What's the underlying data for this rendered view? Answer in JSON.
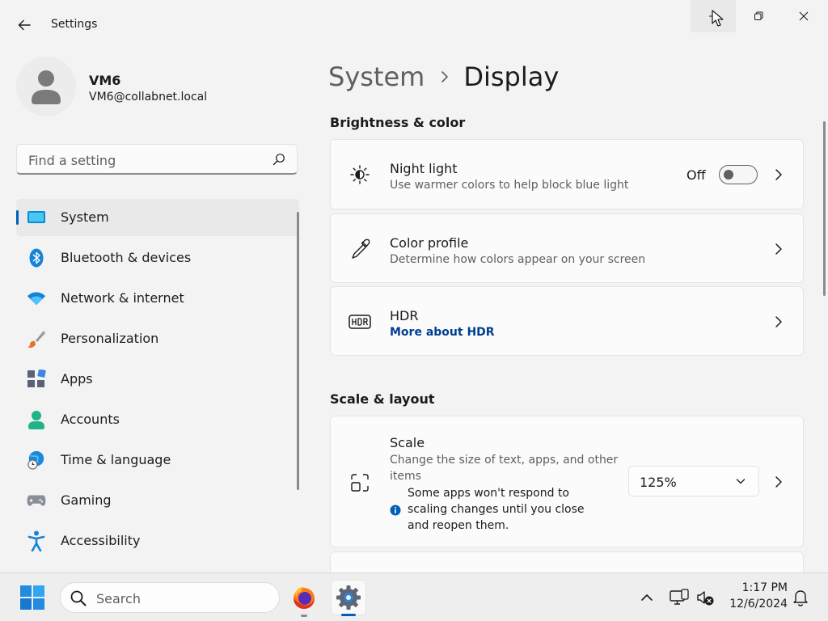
{
  "window": {
    "title": "Settings"
  },
  "profile": {
    "name": "VM6",
    "email": "VM6@collabnet.local"
  },
  "search": {
    "placeholder": "Find a setting"
  },
  "sidebar": {
    "items": [
      {
        "label": "System",
        "icon": "system-icon",
        "active": true
      },
      {
        "label": "Bluetooth & devices",
        "icon": "bluetooth-icon"
      },
      {
        "label": "Network & internet",
        "icon": "wifi-icon"
      },
      {
        "label": "Personalization",
        "icon": "paintbrush-icon"
      },
      {
        "label": "Apps",
        "icon": "apps-icon"
      },
      {
        "label": "Accounts",
        "icon": "accounts-icon"
      },
      {
        "label": "Time & language",
        "icon": "globe-clock-icon"
      },
      {
        "label": "Gaming",
        "icon": "gamepad-icon"
      },
      {
        "label": "Accessibility",
        "icon": "accessibility-icon"
      }
    ]
  },
  "breadcrumb": {
    "parent": "System",
    "current": "Display"
  },
  "sections": {
    "brightness": {
      "title": "Brightness & color",
      "night_light": {
        "title": "Night light",
        "desc": "Use warmer colors to help block blue light",
        "toggle_label": "Off",
        "enabled": false
      },
      "color_profile": {
        "title": "Color profile",
        "desc": "Determine how colors appear on your screen"
      },
      "hdr": {
        "title": "HDR",
        "link": "More about HDR"
      }
    },
    "scale_layout": {
      "title": "Scale & layout",
      "scale": {
        "title": "Scale",
        "desc": "Change the size of text, apps, and other items",
        "note": "Some apps won't respond to scaling changes until you close and reopen them.",
        "value": "125%"
      }
    }
  },
  "taskbar": {
    "search_label": "Search",
    "time": "1:17 PM",
    "date": "12/6/2024"
  },
  "colors": {
    "accent": "#005fb8",
    "link": "#003e92"
  }
}
